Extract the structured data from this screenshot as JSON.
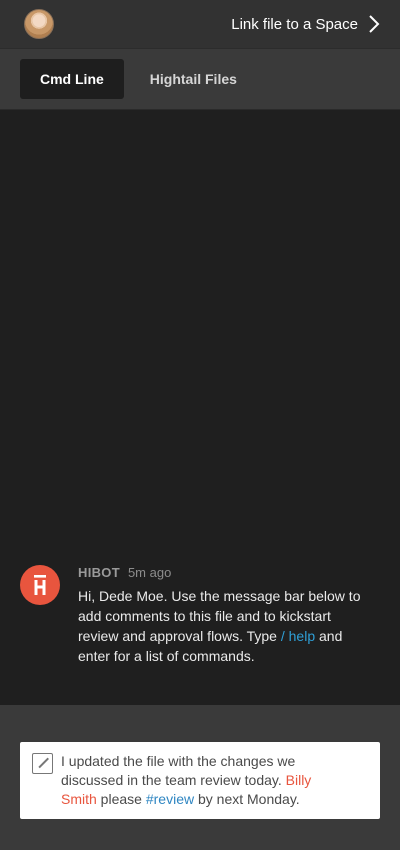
{
  "header": {
    "link_label": "Link file to a Space"
  },
  "tabs": [
    {
      "label": "Cmd Line",
      "active": true
    },
    {
      "label": "Hightail Files",
      "active": false
    }
  ],
  "message": {
    "sender": "HIBOT",
    "time": "5m ago",
    "text_part1": "Hi, Dede Moe. Use the message bar below to add comments to this file and to kickstart review and approval flows. Type ",
    "command": "/ help",
    "text_part2": " and enter for a list of commands."
  },
  "composer": {
    "text_part1": "I updated the file with the changes we discussed in the team review today.  ",
    "mention": "Billy Smith",
    "text_part2": " please ",
    "hashtag": "#review",
    "text_part3": " by next Monday."
  },
  "colors": {
    "accent": "#e8553e",
    "link": "#2f9fd6",
    "header_bg": "#323232",
    "chat_bg": "#1f1f1f"
  },
  "icons": {
    "back_forward": "chevron-right-icon",
    "bot": "hightail-logo-icon",
    "compose": "pencil-icon"
  }
}
